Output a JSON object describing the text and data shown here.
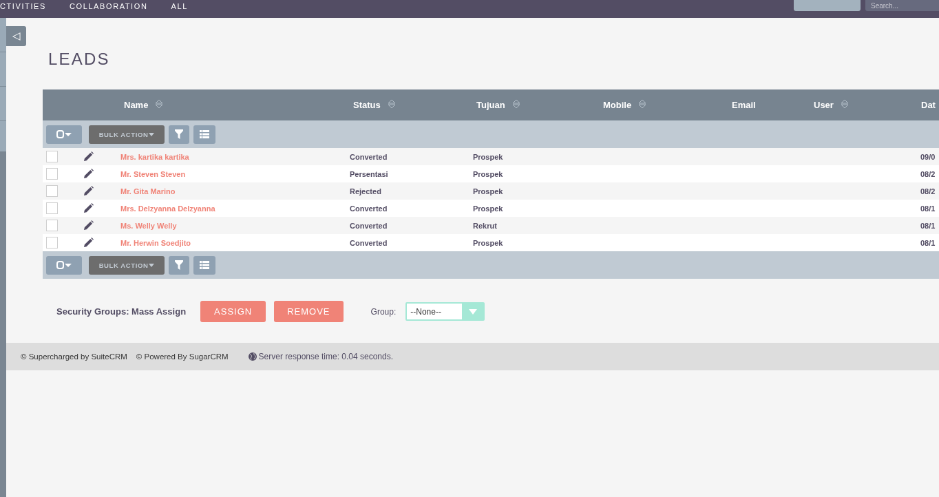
{
  "top_nav": {
    "items": [
      {
        "label": "CTIVITIES"
      },
      {
        "label": "COLLABORATION"
      },
      {
        "label": "ALL"
      }
    ],
    "search": {
      "placeholder": "Search..."
    }
  },
  "sidebar_toggle": {
    "label": "◁"
  },
  "page_title": "LEADS",
  "table": {
    "columns": [
      {
        "label": "Name",
        "sortable": true
      },
      {
        "label": "Status",
        "sortable": true
      },
      {
        "label": "Tujuan",
        "sortable": true
      },
      {
        "label": "Mobile",
        "sortable": true
      },
      {
        "label": "Email",
        "sortable": false
      },
      {
        "label": "User",
        "sortable": true
      },
      {
        "label": "Dat",
        "sortable": false
      }
    ],
    "top_toolbar": {
      "bulk_action": "BULK ACTION",
      "disabled": true
    },
    "rows": [
      {
        "checked": false,
        "name": "Mrs. kartika kartika",
        "status": "Converted",
        "tujuan": "Prospek",
        "column_9": "09/0"
      },
      {
        "checked": false,
        "name": "Mr. Steven Steven",
        "status": "Persentasi",
        "tujuan": "Prospek",
        "column_9": "08/2"
      },
      {
        "checked": false,
        "name": "Mr. Gita Marino",
        "status": "Rejected",
        "tujuan": "Prospek",
        "column_9": "08/2"
      },
      {
        "checked": false,
        "name": "Mrs. Delzyanna Delzyanna",
        "status": "Converted",
        "tujuan": "Prospek",
        "column_9": "08/1"
      },
      {
        "checked": false,
        "name": "Ms. Welly Welly",
        "status": "Converted",
        "tujuan": "Rekrut",
        "column_9": "08/1"
      },
      {
        "checked": false,
        "name": "Mr. Herwin Soedjito",
        "status": "Converted",
        "tujuan": "Prospek",
        "column_9": "08/1"
      }
    ],
    "bottom_toolbar": {
      "bulk_action": "BULK ACTION",
      "disabled": true
    }
  },
  "mass_assign": {
    "label": "Security Groups: Mass Assign",
    "buttons": [
      "ASSIGN",
      "REMOVE"
    ],
    "group_label": "Group:",
    "group_value": "--None--"
  },
  "footer": {
    "credits": [
      "© Supercharged by SuiteCRM",
      "© Powered By SugarCRM"
    ],
    "response_time": "Server response time: 0.04 seconds."
  }
}
